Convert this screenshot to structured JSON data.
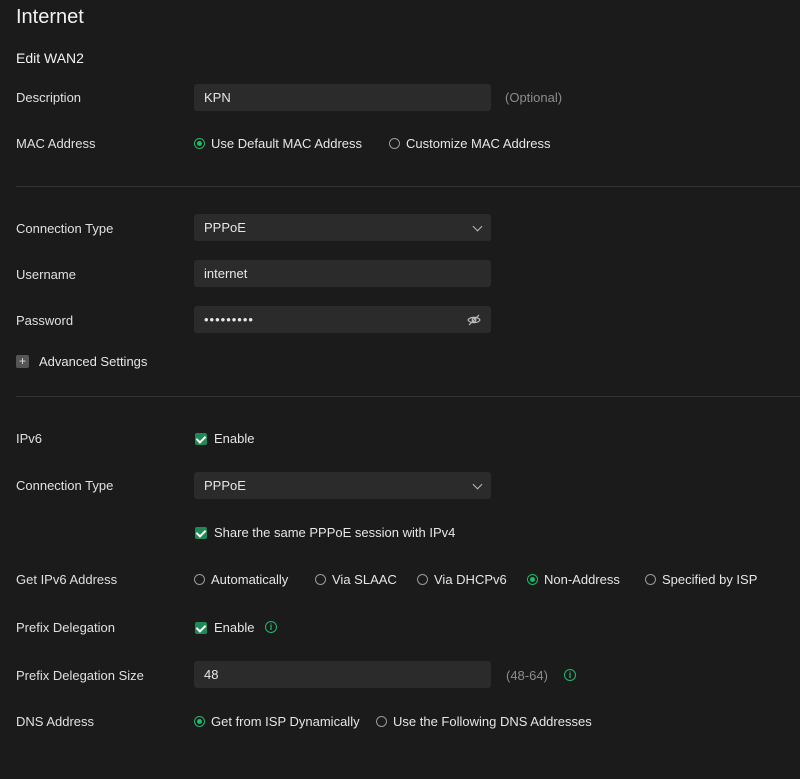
{
  "page": {
    "title": "Internet",
    "subtitle": "Edit WAN2"
  },
  "description": {
    "label": "Description",
    "value": "KPN",
    "hint": "(Optional)"
  },
  "mac": {
    "label": "MAC Address",
    "options": [
      "Use Default MAC Address",
      "Customize MAC Address"
    ],
    "selected": 0
  },
  "connection": {
    "label": "Connection Type",
    "value": "PPPoE"
  },
  "username": {
    "label": "Username",
    "value": "internet"
  },
  "password": {
    "label": "Password",
    "value": "•••••••••"
  },
  "advanced": {
    "label": "Advanced Settings"
  },
  "ipv6": {
    "label": "IPv6",
    "enable_label": "Enable",
    "connection_label": "Connection Type",
    "connection_value": "PPPoE",
    "share_label": "Share the same PPPoE session with IPv4",
    "get_address_label": "Get IPv6 Address",
    "get_address_options": [
      "Automatically",
      "Via SLAAC",
      "Via DHCPv6",
      "Non-Address",
      "Specified by ISP"
    ],
    "get_address_selected": 3,
    "prefix_label": "Prefix Delegation",
    "prefix_enable_label": "Enable",
    "prefix_size_label": "Prefix Delegation Size",
    "prefix_size_value": "48",
    "prefix_size_hint": "(48-64)",
    "dns_label": "DNS Address",
    "dns_options": [
      "Get from ISP Dynamically",
      "Use the Following DNS Addresses"
    ],
    "dns_selected": 0
  },
  "colors": {
    "accent": "#1fb86a",
    "background": "#1b1b1b",
    "field": "#2b2b2b"
  },
  "icons": {
    "info": "info-icon",
    "eye_off": "eye-off-icon",
    "dropdown": "chevron-down-icon",
    "expand": "plus-icon"
  }
}
